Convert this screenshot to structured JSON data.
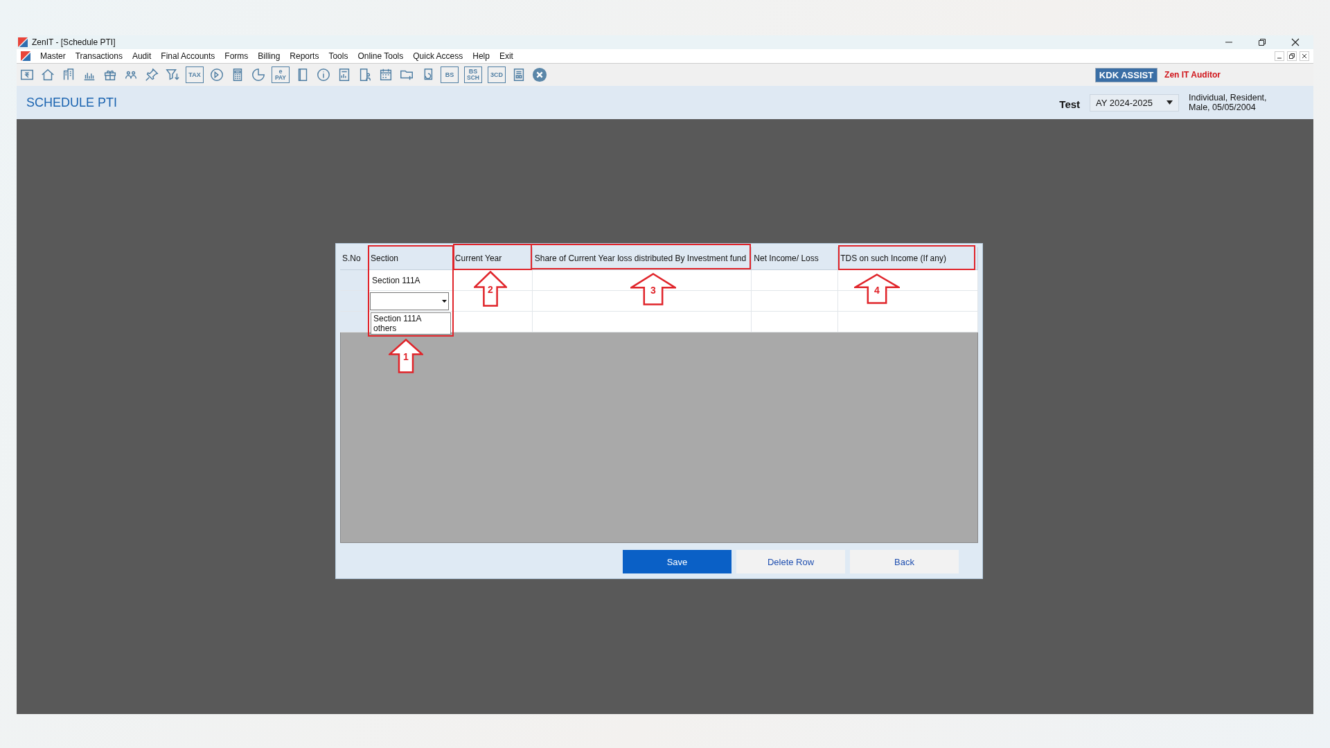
{
  "window": {
    "title": "ZenIT - [Schedule PTI]"
  },
  "menu": [
    "Master",
    "Transactions",
    "Audit",
    "Final Accounts",
    "Forms",
    "Billing",
    "Reports",
    "Tools",
    "Online Tools",
    "Quick Access",
    "Help",
    "Exit"
  ],
  "toolbar": [
    {
      "kind": "rupee-note"
    },
    {
      "kind": "home"
    },
    {
      "kind": "building"
    },
    {
      "kind": "bar-chart"
    },
    {
      "kind": "gift"
    },
    {
      "kind": "people"
    },
    {
      "kind": "pin"
    },
    {
      "kind": "filter"
    },
    {
      "kind": "tax",
      "text": "TAX"
    },
    {
      "kind": "disc"
    },
    {
      "kind": "calculator"
    },
    {
      "kind": "pie-chart"
    },
    {
      "kind": "epay",
      "text": "e",
      "subtext": "PAY"
    },
    {
      "kind": "book"
    },
    {
      "kind": "info"
    },
    {
      "kind": "report"
    },
    {
      "kind": "user-document"
    },
    {
      "kind": "calendar"
    },
    {
      "kind": "folder-plus"
    },
    {
      "kind": "document-refresh"
    },
    {
      "kind": "bs",
      "text": "BS"
    },
    {
      "kind": "bs-sch",
      "text": "BS",
      "subtext": "SCH"
    },
    {
      "kind": "form",
      "text": "3CD"
    },
    {
      "kind": "sheet"
    },
    {
      "kind": "close"
    }
  ],
  "brand": {
    "badge": "KDK ASSIST",
    "product": "Zen IT Auditor"
  },
  "header": {
    "title": "SCHEDULE PTI",
    "client": "Test",
    "year": "AY 2024-2025",
    "info_lines": [
      "Individual, Resident,",
      "Male, 05/05/2004"
    ]
  },
  "grid": {
    "columns": [
      "S.No",
      "Section",
      "Current Year",
      "Share of Current Year loss distributed By Investment fund",
      "Net Income/ Loss",
      "TDS on such Income (If any)"
    ],
    "rows": [
      {
        "kind": "text",
        "section": "Section 111A"
      },
      {
        "kind": "combo"
      },
      {
        "kind": "blank"
      }
    ],
    "dropdown": {
      "options": [
        "Section 111A",
        "others"
      ]
    }
  },
  "buttons": [
    {
      "label": "Save",
      "primary": true
    },
    {
      "label": "Delete Row",
      "primary": false
    },
    {
      "label": "Back",
      "primary": false
    }
  ],
  "annotations": [
    {
      "label": "1"
    },
    {
      "label": "2"
    },
    {
      "label": "3"
    },
    {
      "label": "4"
    }
  ]
}
